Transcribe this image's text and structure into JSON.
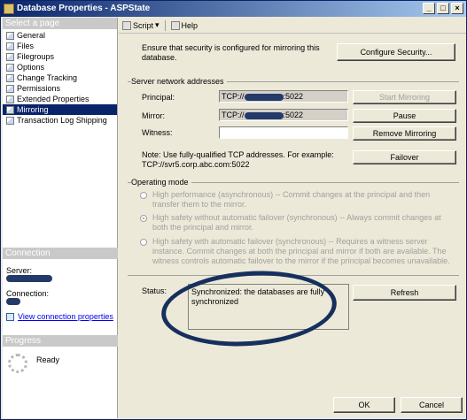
{
  "window": {
    "title": "Database Properties - ASPState",
    "minimize": "_",
    "maximize": "□",
    "close": "×"
  },
  "left": {
    "select_header": "Select a page",
    "pages": [
      {
        "label": "General"
      },
      {
        "label": "Files"
      },
      {
        "label": "Filegroups"
      },
      {
        "label": "Options"
      },
      {
        "label": "Change Tracking"
      },
      {
        "label": "Permissions"
      },
      {
        "label": "Extended Properties"
      },
      {
        "label": "Mirroring"
      },
      {
        "label": "Transaction Log Shipping"
      }
    ],
    "connection_header": "Connection",
    "server_label": "Server:",
    "connection_label": "Connection:",
    "view_props_link": "View connection properties",
    "progress_header": "Progress",
    "progress_status": "Ready"
  },
  "toolbar": {
    "script_label": "Script",
    "help_label": "Help"
  },
  "mirroring": {
    "security_note": "Ensure that security is configured for mirroring this database.",
    "configure_button": "Configure Security...",
    "server_addresses_label": "Server network addresses",
    "principal_label": "Principal:",
    "principal_prefix": "TCP://",
    "principal_suffix": ":5022",
    "mirror_label": "Mirror:",
    "mirror_prefix": "TCP://",
    "mirror_suffix": ":5022",
    "witness_label": "Witness:",
    "witness_value": "",
    "start_button": "Start Mirroring",
    "pause_button": "Pause",
    "remove_button": "Remove Mirroring",
    "failover_button": "Failover",
    "note": "Note: Use fully-qualified TCP addresses. For example:",
    "note_example": "TCP://svr5.corp.abc.com:5022",
    "operating_mode_label": "Operating mode",
    "modes": [
      {
        "text": "High performance (asynchronous) -- Commit changes at the principal and then transfer them to the mirror.",
        "selected": false
      },
      {
        "text": "High safety without automatic failover (synchronous) -- Always commit changes at both the principal and mirror.",
        "selected": true
      },
      {
        "text": "High safety with automatic failover (synchronous) -- Requires a witness server instance. Commit changes at both the principal and mirror if both are available. The witness controls automatic failover to the mirror if the principal becomes unavailable.",
        "selected": false
      }
    ],
    "status_label": "Status:",
    "status_text": "Synchronized: the databases are fully synchronized",
    "refresh_button": "Refresh"
  },
  "footer": {
    "ok_button": "OK",
    "cancel_button": "Cancel"
  },
  "colors": {
    "title_bar": "#0a246a",
    "selected_nav": "#0a246a",
    "annotation_ellipse": "#16305e"
  }
}
